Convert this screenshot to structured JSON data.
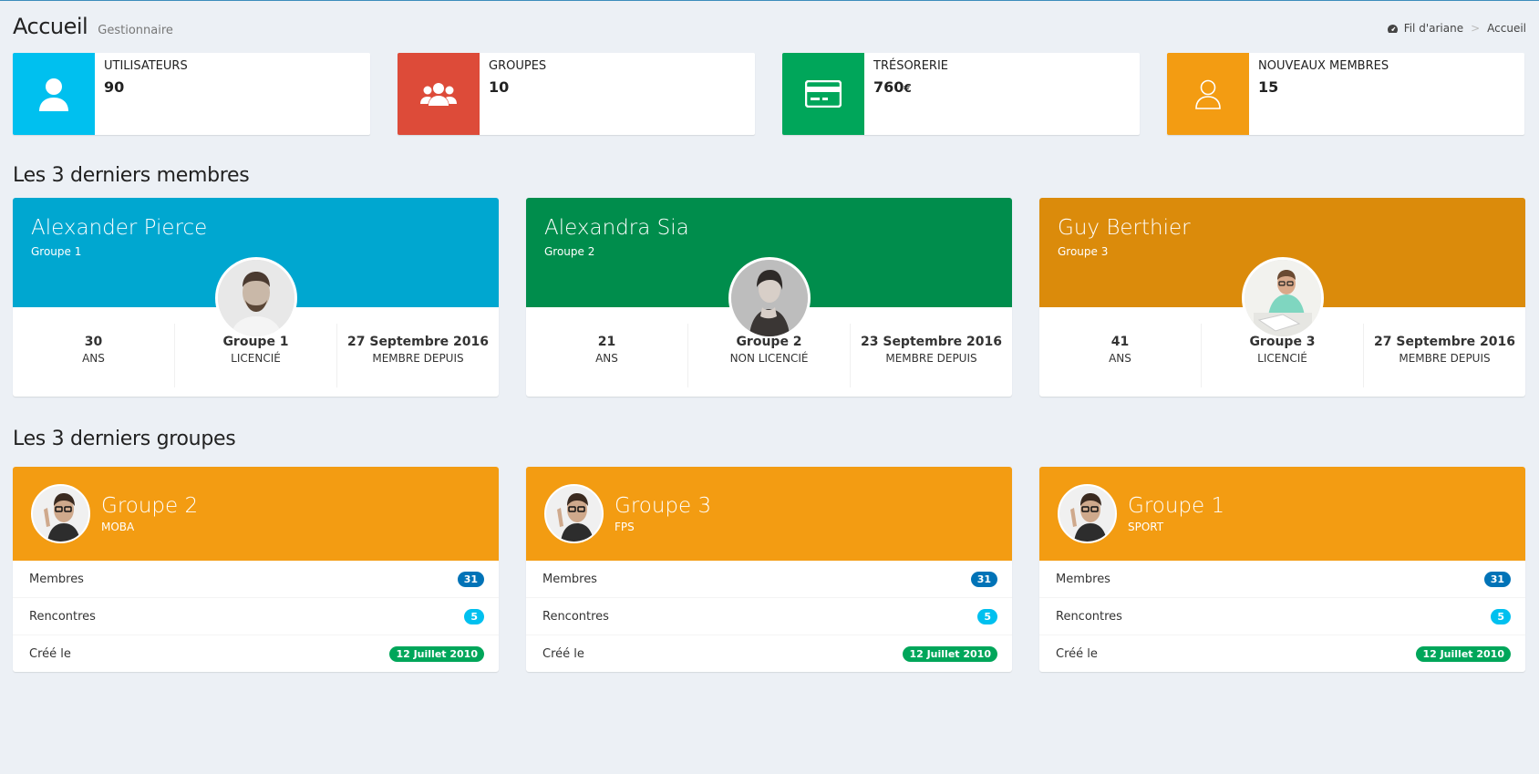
{
  "header": {
    "title": "Accueil",
    "subtitle": "Gestionnaire",
    "breadcrumb": {
      "root": "Fil d'ariane",
      "current": "Accueil"
    }
  },
  "info_boxes": [
    {
      "label": "UTILISATEURS",
      "value": "90",
      "icon": "user-icon",
      "color": "#00c0ef"
    },
    {
      "label": "GROUPES",
      "value": "10",
      "icon": "users-group-icon",
      "color": "#dd4b39"
    },
    {
      "label": "TRÉSORERIE",
      "value": "760",
      "unit": "€",
      "icon": "credit-card-icon",
      "color": "#00a65a"
    },
    {
      "label": "NOUVEAUX MEMBRES",
      "value": "15",
      "icon": "user-outline-icon",
      "color": "#f39c12"
    }
  ],
  "members_section": {
    "title": "Les 3 derniers membres",
    "members": [
      {
        "name": "Alexander Pierce",
        "group": "Groupe 1",
        "color": "#00a7d0",
        "age": "30",
        "age_label": "ANS",
        "group_stat": "Groupe 1",
        "license": "LICENCIÉ",
        "since": "27 Septembre 2016",
        "since_label": "MEMBRE DEPUIS"
      },
      {
        "name": "Alexandra Sia",
        "group": "Groupe 2",
        "color": "#008d4c",
        "age": "21",
        "age_label": "ANS",
        "group_stat": "Groupe 2",
        "license": "NON LICENCIÉ",
        "since": "23 Septembre 2016",
        "since_label": "MEMBRE DEPUIS"
      },
      {
        "name": "Guy Berthier",
        "group": "Groupe 3",
        "color": "#db8b0b",
        "age": "41",
        "age_label": "ANS",
        "group_stat": "Groupe 3",
        "license": "LICENCIÉ",
        "since": "27 Septembre 2016",
        "since_label": "MEMBRE DEPUIS"
      }
    ]
  },
  "groups_section": {
    "title": "Les 3 derniers groupes",
    "groups": [
      {
        "name": "Groupe 2",
        "game": "MOBA",
        "rows": [
          {
            "label": "Membres",
            "value": "31",
            "color": "#0073b7"
          },
          {
            "label": "Rencontres",
            "value": "5",
            "color": "#00c0ef"
          },
          {
            "label": "Créé le",
            "value": "12 Juillet 2010",
            "color": "#00a65a"
          }
        ]
      },
      {
        "name": "Groupe 3",
        "game": "FPS",
        "rows": [
          {
            "label": "Membres",
            "value": "31",
            "color": "#0073b7"
          },
          {
            "label": "Rencontres",
            "value": "5",
            "color": "#00c0ef"
          },
          {
            "label": "Créé le",
            "value": "12 Juillet 2010",
            "color": "#00a65a"
          }
        ]
      },
      {
        "name": "Groupe 1",
        "game": "SPORT",
        "rows": [
          {
            "label": "Membres",
            "value": "31",
            "color": "#0073b7"
          },
          {
            "label": "Rencontres",
            "value": "5",
            "color": "#00c0ef"
          },
          {
            "label": "Créé le",
            "value": "12 Juillet 2010",
            "color": "#00a65a"
          }
        ]
      }
    ]
  }
}
